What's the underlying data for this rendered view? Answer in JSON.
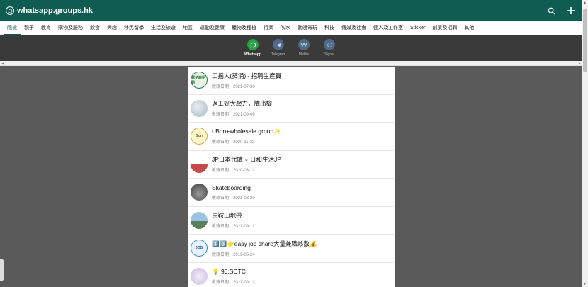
{
  "brand": {
    "name": "whatsapp.groups.hk"
  },
  "categories": [
    "隨機",
    "親子",
    "教育",
    "購物及服務",
    "飲食",
    "興趣",
    "移民留學",
    "生活及旅遊",
    "地區",
    "運動及健康",
    "寵物及種植",
    "行業",
    "吹水",
    "動漫電玩",
    "科技",
    "傳媒及社會",
    "個人及工作室",
    "Sticker",
    "創業及招聘",
    "其他"
  ],
  "platforms": [
    {
      "label": "Whatsapp",
      "color": "#25a244"
    },
    {
      "label": "Telegram",
      "color": "#4e6a88"
    },
    {
      "label": "MeWe",
      "color": "#4e6a88"
    },
    {
      "label": "Signal",
      "color": "#4e6a88"
    }
  ],
  "groups": [
    {
      "title": "工摇人(葵涌) - 招聘生產員",
      "date": "收錄日期：2021-07-30",
      "avatar_text": "電子廠招聘",
      "avatar_color": "#2f7a44"
    },
    {
      "title": "返工好大壓力，講出黎",
      "date": "收錄日期：2021-09-09",
      "avatar_text": "",
      "avatar_color": "#b9c6cf"
    },
    {
      "title": "□Bon+wholesale group✨",
      "date": "收錄日期：2020-11-22",
      "avatar_text": "Bon",
      "avatar_color": "#c9b24a"
    },
    {
      "title": "JP日本代購 ∘ 日和生活JP",
      "date": "收錄日期：2020-03-12",
      "avatar_text": "",
      "avatar_color": "#c24b4b"
    },
    {
      "title": "Skateboarding",
      "date": "收錄日期：2021-08-20",
      "avatar_text": "",
      "avatar_color": "#6a6a6a"
    },
    {
      "title": "馬鞍山地帶",
      "date": "收錄日期：2021-09-12",
      "avatar_text": "",
      "avatar_color": "#5b8fb5"
    },
    {
      "title": "1️⃣3️⃣🌟easy job share大量兼職炒散💰",
      "date": "收錄日期：2019-05-24",
      "avatar_text": "JOB",
      "avatar_color": "#3d8bc9"
    },
    {
      "title": "💡 90.SCTC",
      "date": "收錄日期：2021-09-13",
      "avatar_text": "",
      "avatar_color": "#c8b8dc"
    }
  ]
}
